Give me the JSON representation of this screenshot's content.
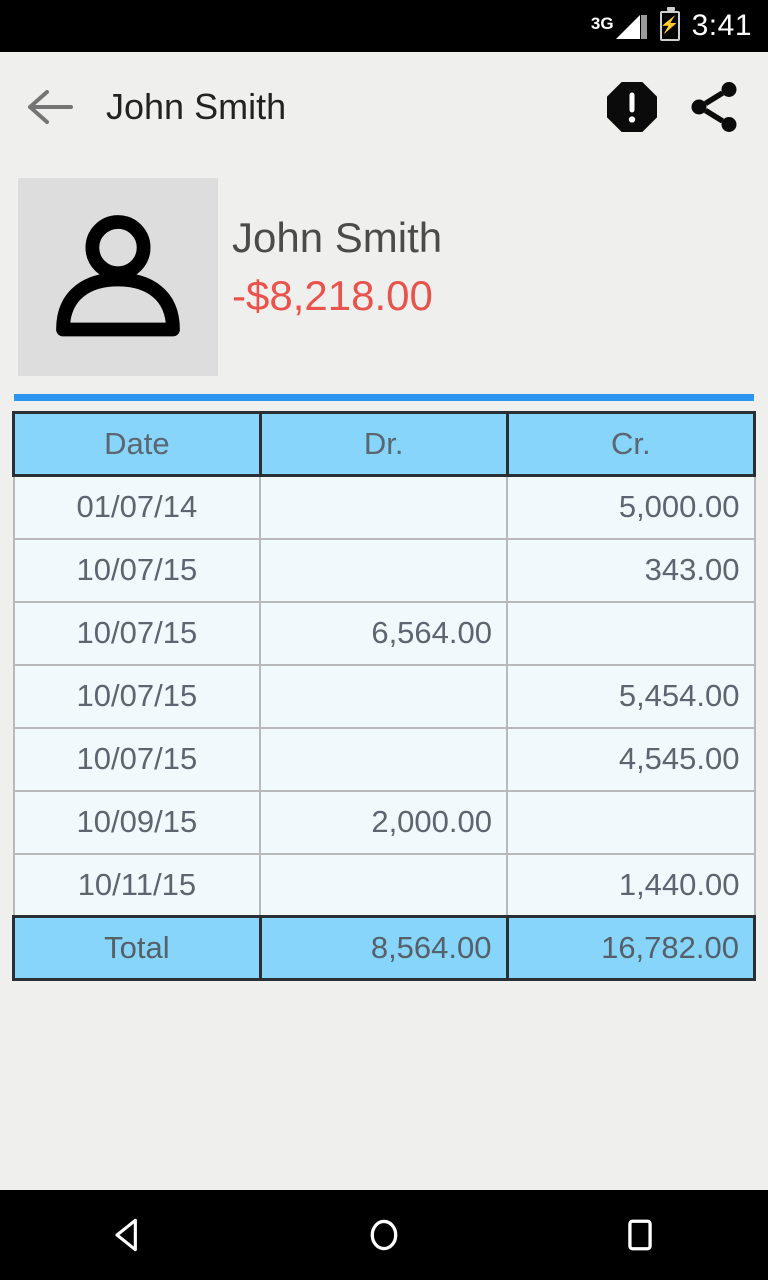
{
  "status_bar": {
    "network": "3G",
    "battery_icon": "battery-charging-icon",
    "time": "3:41"
  },
  "toolbar": {
    "back_icon": "back-arrow-icon",
    "title": "John Smith",
    "alert_icon": "alert-octagon-icon",
    "share_icon": "share-icon"
  },
  "profile": {
    "avatar_icon": "person-icon",
    "name": "John Smith",
    "balance": "-$8,218.00",
    "balance_color": "#e8534c"
  },
  "colors": {
    "accent_blue": "#2b95ef",
    "header_blue": "#87d5fa",
    "row_blue": "#f0fafd",
    "background": "#efefee",
    "negative_red": "#e8534c"
  },
  "ledger": {
    "columns": [
      "Date",
      "Dr.",
      "Cr."
    ],
    "rows": [
      {
        "date": "01/07/14",
        "dr": "",
        "cr": "5,000.00"
      },
      {
        "date": "10/07/15",
        "dr": "",
        "cr": "343.00"
      },
      {
        "date": "10/07/15",
        "dr": "6,564.00",
        "cr": ""
      },
      {
        "date": "10/07/15",
        "dr": "",
        "cr": "5,454.00"
      },
      {
        "date": "10/07/15",
        "dr": "",
        "cr": "4,545.00"
      },
      {
        "date": "10/09/15",
        "dr": "2,000.00",
        "cr": ""
      },
      {
        "date": "10/11/15",
        "dr": "",
        "cr": "1,440.00"
      }
    ],
    "total": {
      "label": "Total",
      "dr": "8,564.00",
      "cr": "16,782.00"
    }
  },
  "nav_bar": {
    "back": "nav-back-icon",
    "home": "nav-home-icon",
    "recents": "nav-recents-icon"
  }
}
